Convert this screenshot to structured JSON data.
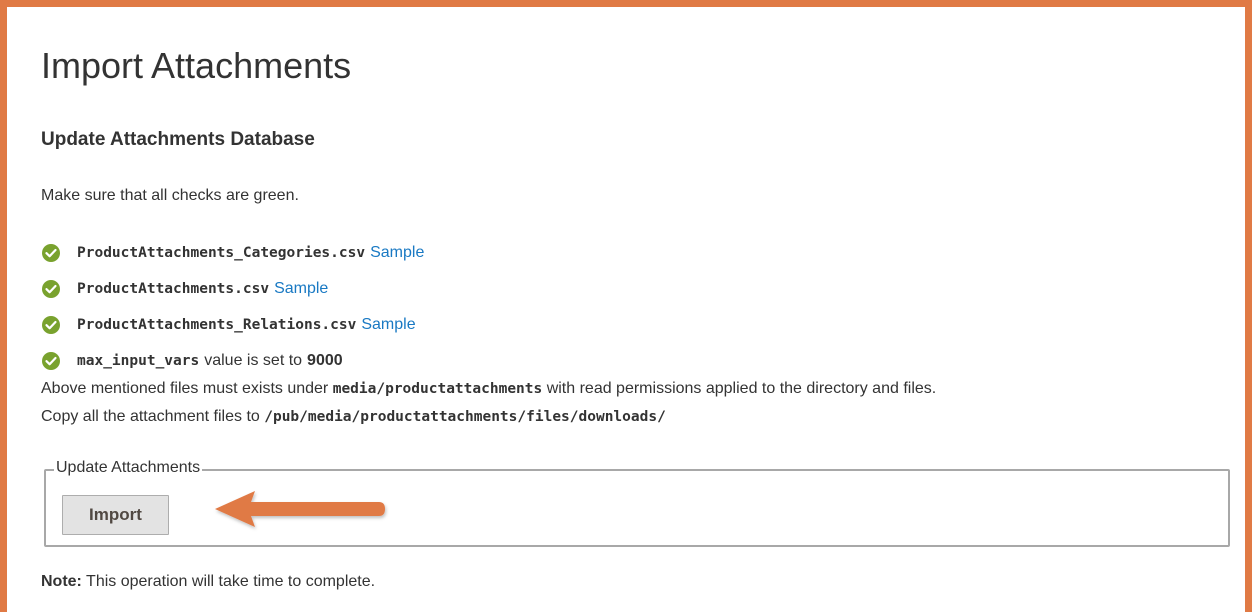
{
  "page": {
    "title": "Import Attachments",
    "section_title": "Update Attachments Database",
    "intro": "Make sure that all checks are green."
  },
  "checks": [
    {
      "filename": "ProductAttachments_Categories.csv",
      "link_label": "Sample",
      "status": "ok"
    },
    {
      "filename": "ProductAttachments.csv",
      "link_label": "Sample",
      "status": "ok"
    },
    {
      "filename": "ProductAttachments_Relations.csv",
      "link_label": "Sample",
      "status": "ok"
    }
  ],
  "php_check": {
    "name": "max_input_vars",
    "text": "value is set to",
    "value": "9000",
    "status": "ok"
  },
  "requirements": {
    "line1_prefix": "Above mentioned files must exists under",
    "line1_path": "media/productattachments",
    "line1_suffix": "with read permissions applied to the directory and files.",
    "line2_prefix": "Copy all the attachment files to",
    "line2_path": "/pub/media/productattachments/files/downloads/"
  },
  "update_fieldset": {
    "legend": "Update Attachments",
    "button_label": "Import"
  },
  "footer": {
    "note_label": "Note:",
    "note_text": "This operation will take time to complete."
  },
  "colors": {
    "frame_border": "#e07a45",
    "arrow": "#e07a45",
    "check_green": "#79a22e",
    "link": "#1979c3"
  },
  "icons": {
    "check": "check-circle-icon",
    "arrow": "arrow-left-annotation"
  }
}
